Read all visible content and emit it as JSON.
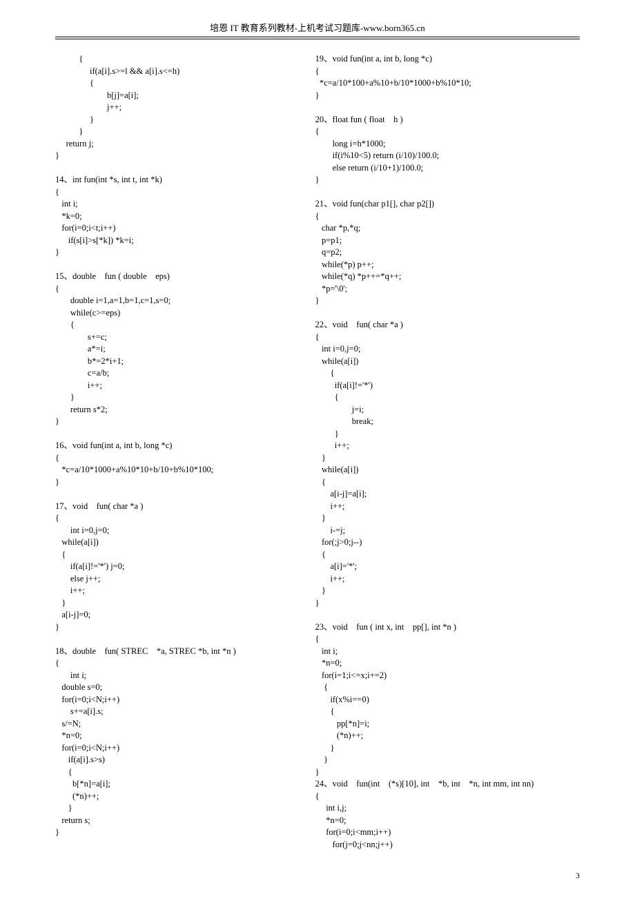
{
  "header": "培恩 IT 教育系列教材-上机考试习题库-www.born365.cn",
  "page_number": "3",
  "left": "           {\n                if(a[i].s>=l && a[i].s<=h)\n                {\n                        b[j]=a[i];\n                        j++;\n                }\n           }\n     return j;\n}\n\n14、int fun(int *s, int t, int *k)\n{\n   int i;\n   *k=0;\n   for(i=0;i<t;i++)\n      if(s[i]>s[*k]) *k=i;\n}\n\n15、double    fun ( double    eps)\n{\n       double i=1,a=1,b=1,c=1,s=0;\n       while(c>=eps)\n       {\n               s+=c;\n               a*=i;\n               b*=2*i+1;\n               c=a/b;\n               i++;\n       }\n       return s*2;\n}\n\n16、void fun(int a, int b, long *c)\n{\n   *c=a/10*1000+a%10*10+b/10+b%10*100;\n}\n\n17、void    fun( char *a )\n{\n       int i=0,j=0;\n   while(a[i])\n   {\n       if(a[i]!='*') j=0;\n       else j++;\n       i++;\n   }\n   a[i-j]=0;\n}\n\n18、double    fun( STREC    *a, STREC *b, int *n )\n{\n       int i;\n   double s=0;\n   for(i=0;i<N;i++)\n       s+=a[i].s;\n   s/=N;\n   *n=0;\n   for(i=0;i<N;i++)\n      if(a[i].s>s)\n      {\n        b[*n]=a[i];\n        (*n)++;\n      }\n   return s;\n}",
  "right": "19、void fun(int a, int b, long *c)\n{\n  *c=a/10*100+a%10+b/10*1000+b%10*10;\n}\n\n20、float fun ( float    h )\n{\n        long i=h*1000;\n        if(i%10<5) return (i/10)/100.0;\n        else return (i/10+1)/100.0;\n}\n\n21、void fun(char p1[], char p2[])\n{\n   char *p,*q;\n   p=p1;\n   q=p2;\n   while(*p) p++;\n   while(*q) *p++=*q++;\n   *p='\\0';\n}\n\n22、void    fun( char *a )\n{\n   int i=0,j=0;\n   while(a[i])\n       {\n         if(a[i]!='*')\n         {\n                 j=i;\n                 break;\n         }\n         i++;\n   }\n   while(a[i])\n   {\n       a[i-j]=a[i];\n       i++;\n   }\n       i-=j;\n   for(;j>0;j--)\n   {\n       a[i]='*';\n       i++;\n   }\n}\n\n23、void    fun ( int x, int    pp[], int *n )\n{\n   int i;\n   *n=0;\n   for(i=1;i<=x;i+=2)\n    {\n       if(x%i==0)\n       {\n          pp[*n]=i;\n          (*n)++;\n       }\n    }\n}\n24、void    fun(int    (*s)[10], int    *b, int    *n, int mm, int nn)\n{\n     int i,j;\n     *n=0;\n     for(i=0;i<mm;i++)\n        for(j=0;j<nn;j++)"
}
